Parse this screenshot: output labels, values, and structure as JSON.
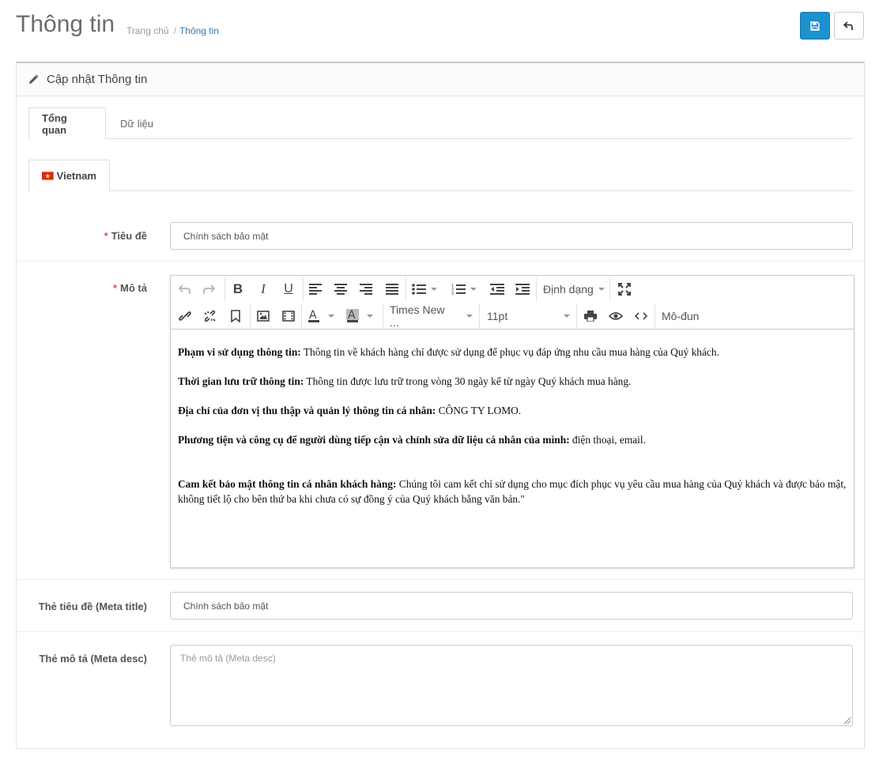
{
  "header": {
    "title": "Thông tin",
    "breadcrumb": {
      "home": "Trang chủ",
      "current": "Thông tin"
    }
  },
  "panel": {
    "heading": "Cập nhật Thông tin"
  },
  "tabs": {
    "overview": "Tổng quan",
    "data": "Dữ liệu"
  },
  "language_tab": {
    "label": "Vietnam"
  },
  "form": {
    "title_label": "Tiêu đề",
    "title_value": "Chính sách bảo mật",
    "description_label": "Mô tả",
    "meta_title_label": "Thẻ tiêu đề (Meta title)",
    "meta_title_value": "Chính sách bảo mật",
    "meta_desc_label": "Thẻ mô tả (Meta desc)",
    "meta_desc_placeholder": "Thẻ mô tả (Meta desc)"
  },
  "editor": {
    "toolbar": {
      "format_label": "Định dạng",
      "font_label": "Times New ...",
      "size_label": "11pt",
      "module_label": "Mô-đun"
    },
    "content": [
      {
        "bold": "Phạm vi sử dụng thông tin:",
        "text": " Thông tin về khách hàng chỉ được sử dụng để phục vụ đáp ứng nhu cầu mua hàng của Quý khách."
      },
      {
        "bold": "Thời gian lưu trữ thông tin:",
        "text": " Thông tin được lưu trữ trong vòng 30 ngày kể từ ngày Quý khách mua hàng."
      },
      {
        "bold": "Địa chỉ của đơn vị thu thập và quản lý thông tin cá nhân:",
        "text": " CÔNG TY LOMO."
      },
      {
        "bold": "Phương tiện và công cụ để người dùng tiếp cận và chỉnh sửa dữ liệu cá nhân của mình:",
        "text": " điện thoại, email."
      },
      {
        "bold": "Cam kết bảo mật thông tin cá nhân khách hàng:",
        "text": " Chúng tôi cam kết chỉ sử dụng cho mục đích phục vụ yêu cầu mua hàng của Quý khách và được bảo mật, không tiết lộ cho bên thứ ba khi chưa có sự đồng ý của Quý khách bằng văn bản.\""
      }
    ]
  },
  "colors": {
    "primary": "#1e91cf",
    "required": "#e3503e",
    "link": "#337ab7"
  },
  "icons": [
    "save-icon",
    "back-icon",
    "pencil-icon",
    "vietnam-flag-icon"
  ]
}
